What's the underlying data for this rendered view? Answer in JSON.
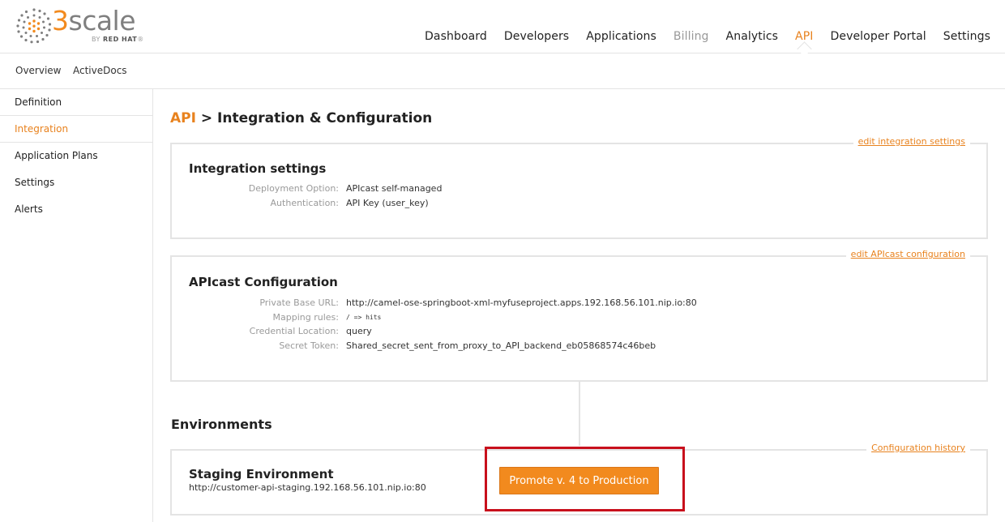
{
  "brand": {
    "word_accent": "3",
    "word_rest": "scale",
    "by_prefix": "BY",
    "by_name": "RED HAT",
    "trademark": "®"
  },
  "topnav": {
    "dashboard": "Dashboard",
    "developers": "Developers",
    "applications": "Applications",
    "billing": "Billing",
    "analytics": "Analytics",
    "api": "API",
    "developer_portal": "Developer Portal",
    "settings": "Settings"
  },
  "subnav": {
    "overview": "Overview",
    "activedocs": "ActiveDocs"
  },
  "sidebar": {
    "items": [
      {
        "label": "Definition"
      },
      {
        "label": "Integration"
      },
      {
        "label": "Application Plans"
      },
      {
        "label": "Settings"
      },
      {
        "label": "Alerts"
      }
    ]
  },
  "page": {
    "crumb": "API",
    "separator": " > ",
    "title": "Integration & Configuration"
  },
  "integration": {
    "link": "edit integration settings",
    "heading": "Integration settings",
    "rows": [
      {
        "label": "Deployment Option:",
        "value": "APIcast self-managed"
      },
      {
        "label": "Authentication:",
        "value": "API Key (user_key)"
      }
    ]
  },
  "apicast": {
    "link": "edit APIcast configuration",
    "heading": "APIcast Configuration",
    "rows": [
      {
        "label": "Private Base URL:",
        "value": "http://camel-ose-springboot-xml-myfuseproject.apps.192.168.56.101.nip.io:80"
      },
      {
        "label": "Mapping rules:",
        "value": "/ => hits"
      },
      {
        "label": "Credential Location:",
        "value": "query"
      },
      {
        "label": "Secret Token:",
        "value": "Shared_secret_sent_from_proxy_to_API_backend_eb05868574c46beb"
      }
    ]
  },
  "environments": {
    "heading": "Environments",
    "history_link": "Configuration history",
    "staging_title": "Staging Environment",
    "staging_url": "http://customer-api-staging.192.168.56.101.nip.io:80",
    "promote_label": "Promote v. 4 to Production"
  },
  "colors": {
    "accent": "#e8821e",
    "button": "#f28a1e",
    "highlight": "#c8101c",
    "border": "#e4e4e4"
  }
}
